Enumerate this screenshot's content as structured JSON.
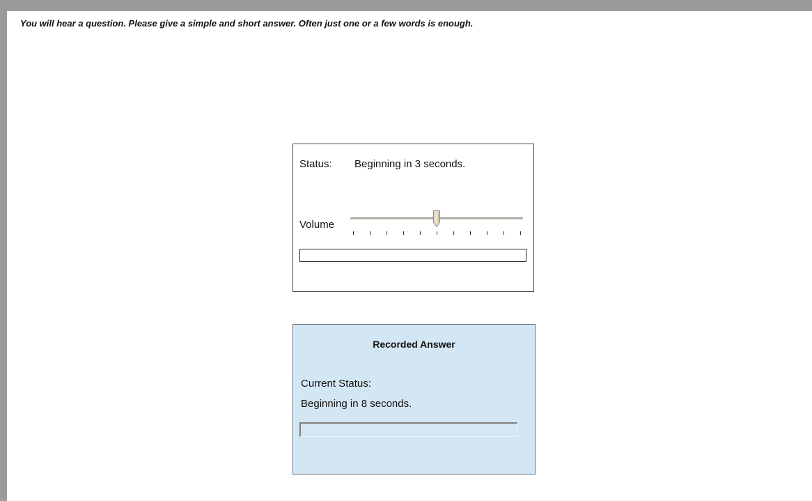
{
  "instructions": "You will hear a question. Please give a simple and short answer. Often just one or a few words is enough.",
  "player": {
    "status_label": "Status:",
    "status_text": "Beginning in 3 seconds.",
    "volume_label": "Volume",
    "volume_level": 0.5,
    "volume_ticks": 11,
    "progress": 0
  },
  "recorder": {
    "title": "Recorded Answer",
    "current_status_label": "Current Status:",
    "current_status_value": "Beginning in 8 seconds.",
    "progress": 0
  },
  "colors": {
    "frame_border": "#9b9b9b",
    "recorder_background": "#d3e6f3",
    "slider_thumb": "#e7dfc8"
  },
  "icons": {
    "slider_thumb": "slider-thumb-icon"
  }
}
